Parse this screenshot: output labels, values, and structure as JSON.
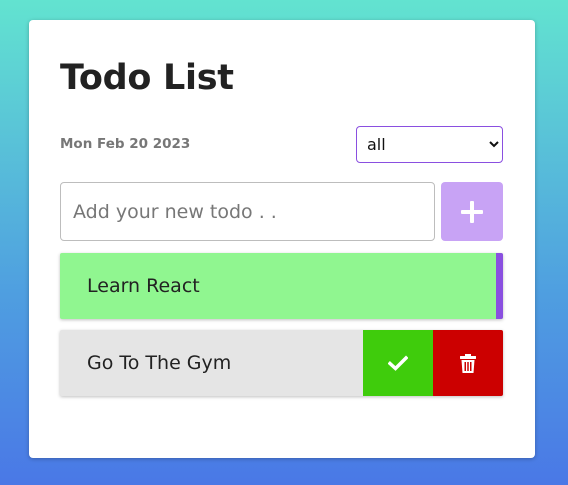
{
  "header": {
    "title": "Todo List",
    "date": "Mon Feb 20 2023"
  },
  "filter": {
    "selected": "all",
    "options": [
      "all"
    ]
  },
  "input": {
    "placeholder": "Add your new todo . .",
    "value": ""
  },
  "add_button": {
    "icon": "plus-icon"
  },
  "todos": [
    {
      "text": "Learn React",
      "completed": true
    },
    {
      "text": "Go To The Gym",
      "completed": false,
      "actions": [
        "check-icon",
        "trash-icon"
      ]
    }
  ],
  "colors": {
    "background_top": "#62e3d0",
    "background_bottom": "#4a78e6",
    "accent": "#8a4fe0",
    "add_button": "#c8a3f5",
    "completed_item": "#90f690",
    "pending_item": "#e5e5e5",
    "check_button": "#3fcc0c",
    "trash_button": "#cc0000"
  }
}
